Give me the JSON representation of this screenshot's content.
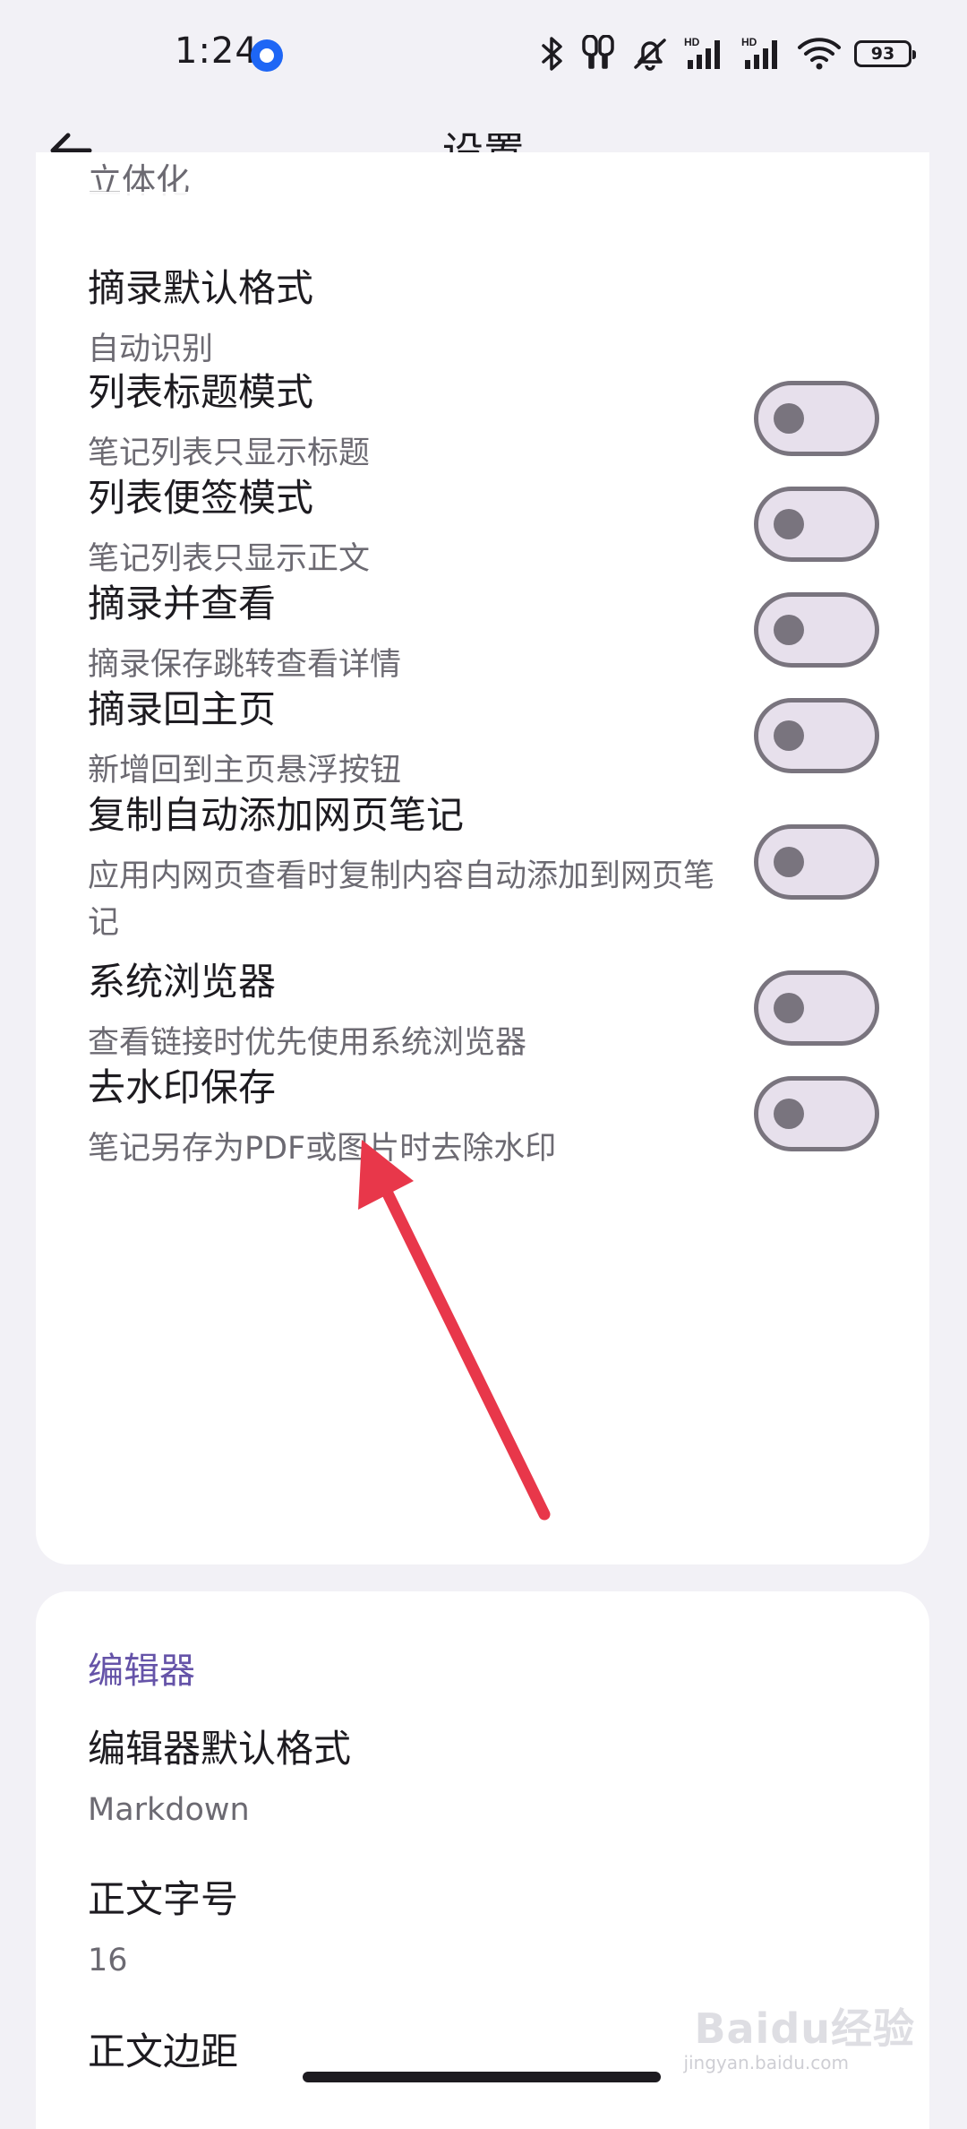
{
  "status_bar": {
    "time": "1:24",
    "battery": "93",
    "icons": [
      "bluetooth-icon",
      "earbuds-icon",
      "mute-icon",
      "signal-hd-icon",
      "signal-hd-icon",
      "wifi-icon",
      "battery-icon"
    ]
  },
  "app_bar": {
    "title": "设置"
  },
  "general": {
    "partial_top_label": "立体化",
    "items": [
      {
        "title": "摘录默认格式",
        "subtitle": "自动识别"
      },
      {
        "title": "列表标题模式",
        "subtitle": "笔记列表只显示标题",
        "on": false
      },
      {
        "title": "列表便签模式",
        "subtitle": "笔记列表只显示正文",
        "on": false
      },
      {
        "title": "摘录并查看",
        "subtitle": "摘录保存跳转查看详情",
        "on": false
      },
      {
        "title": "摘录回主页",
        "subtitle": "新增回到主页悬浮按钮",
        "on": false
      },
      {
        "title": "复制自动添加网页笔记",
        "subtitle": "应用内网页查看时复制内容自动添加到网页笔记",
        "on": false
      },
      {
        "title": "系统浏览器",
        "subtitle": "查看链接时优先使用系统浏览器",
        "on": false
      },
      {
        "title": "去水印保存",
        "subtitle": "笔记另存为PDF或图片时去除水印",
        "on": false
      }
    ]
  },
  "editor": {
    "header": "编辑器",
    "items": [
      {
        "title": "编辑器默认格式",
        "subtitle": "Markdown"
      },
      {
        "title": "正文字号",
        "subtitle": "16"
      },
      {
        "title": "正文边距"
      }
    ]
  },
  "colors": {
    "accent": "#6553a8",
    "annotation_arrow": "#e8374a",
    "switch_off_track": "#e7e0ec",
    "switch_off_outline": "#79747e"
  },
  "watermark": {
    "brand": "Baidu经验",
    "sub": "jingyan.baidu.com"
  }
}
